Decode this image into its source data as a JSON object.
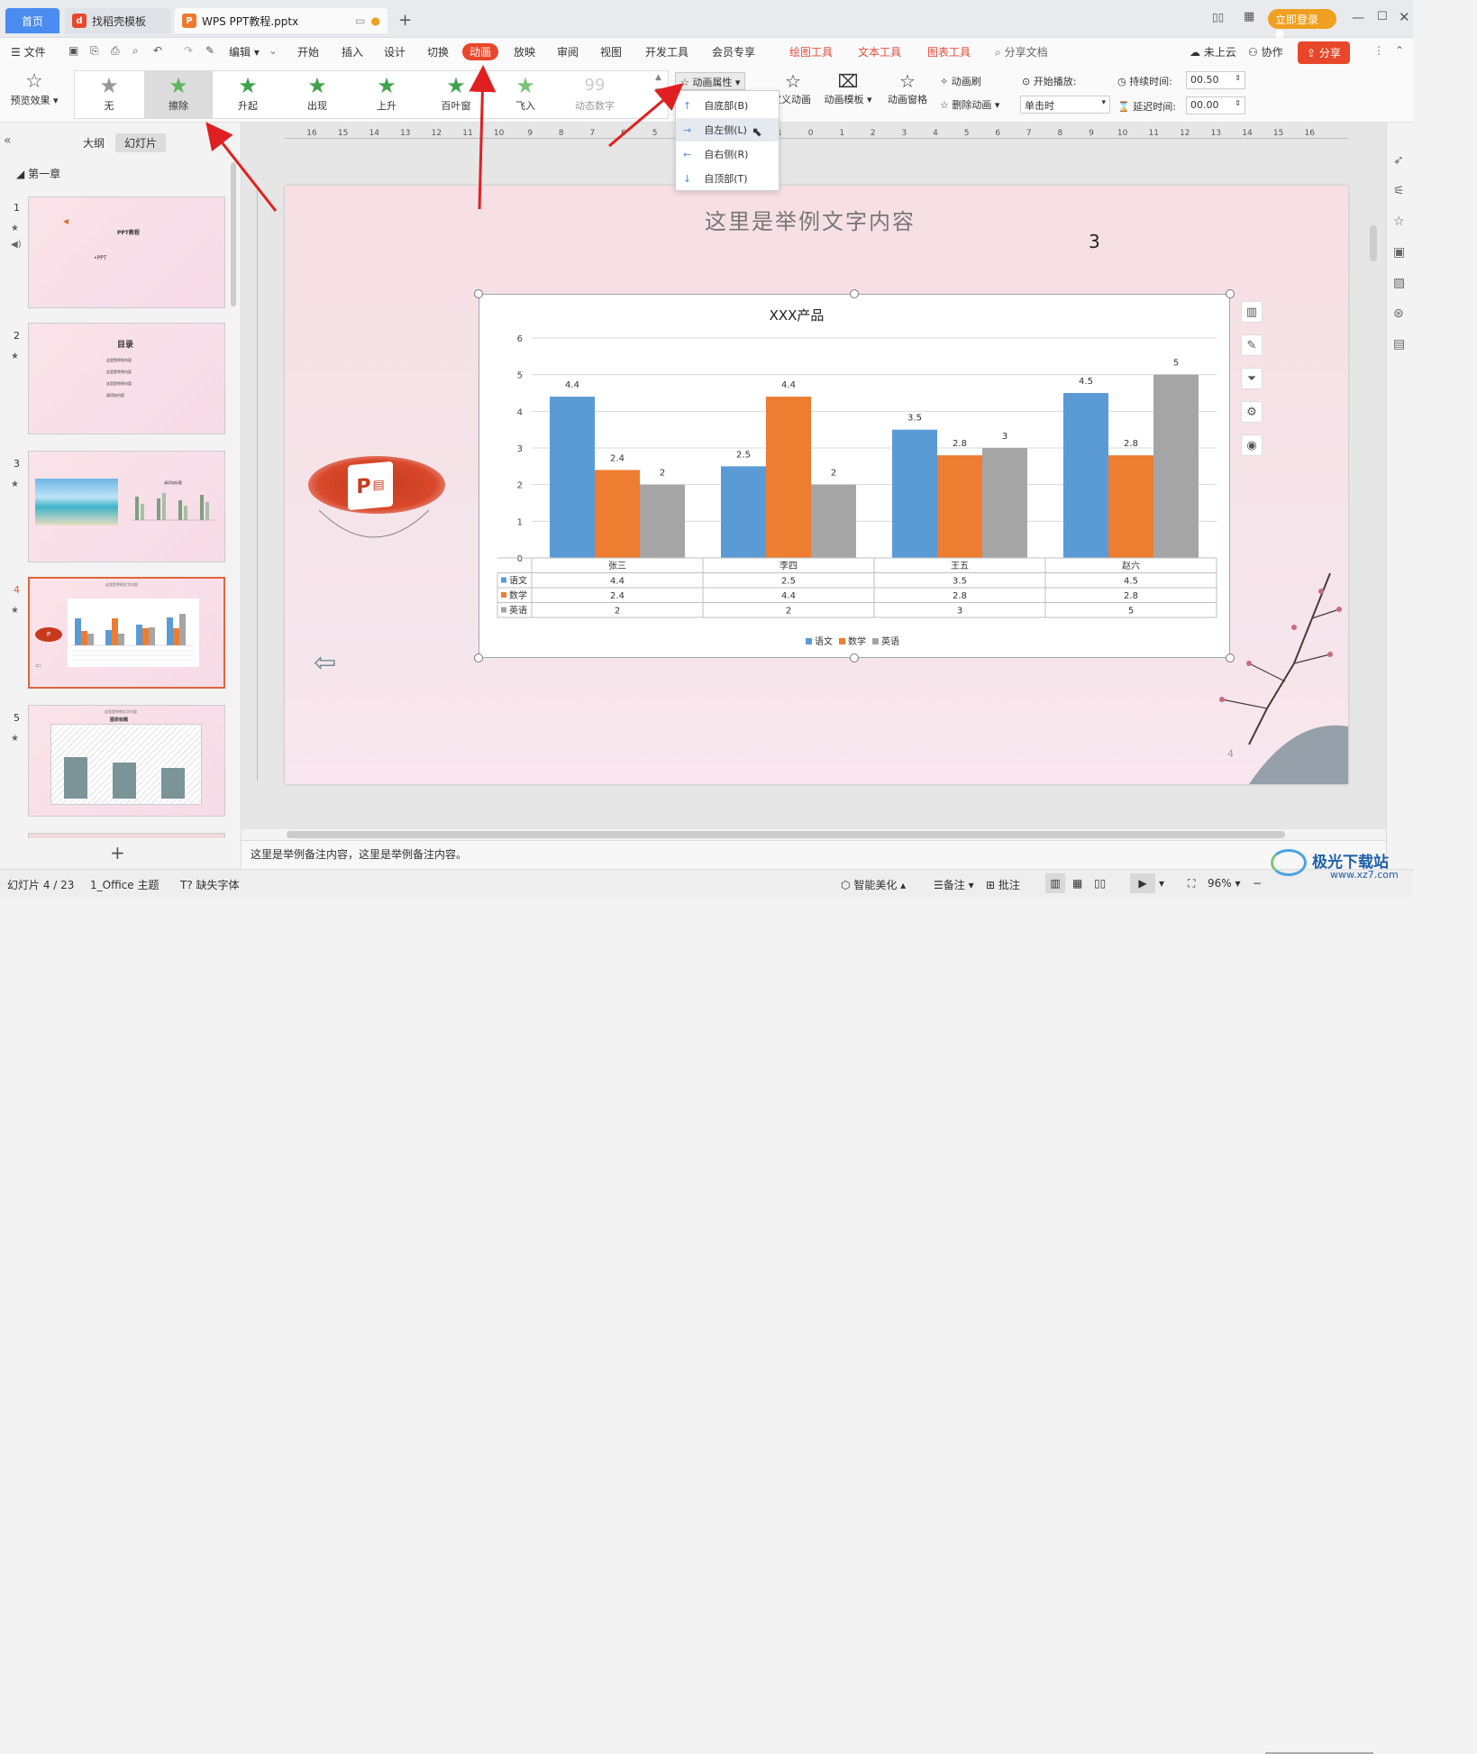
{
  "tabs": {
    "home": "首页",
    "template": "找稻壳模板",
    "doc": "WPS PPT教程.pptx"
  },
  "window": {
    "login": "立即登录"
  },
  "menu": {
    "file": "文件",
    "edit": "编辑",
    "items": [
      "开始",
      "插入",
      "设计",
      "切换",
      "动画",
      "放映",
      "审阅",
      "视图",
      "开发工具",
      "会员专享"
    ],
    "tools": [
      "绘图工具",
      "文本工具",
      "图表工具"
    ],
    "search": "分享文档",
    "cloud": "未上云",
    "collab": "协作",
    "share": "分享"
  },
  "ribbon": {
    "preview": "预览效果",
    "effects": [
      "无",
      "擦除",
      "升起",
      "出现",
      "上升",
      "百叶窗",
      "飞入",
      "动态数字"
    ],
    "anim_props": "动画属性",
    "custom_anim": "自定义动画",
    "templates": "动画模板",
    "pane": "动画窗格",
    "brush": "动画刷",
    "delete": "删除动画",
    "start_label": "开始播放:",
    "start_value": "单击时",
    "duration_label": "持续时间:",
    "duration_value": "00.50",
    "delay_label": "延迟时间:",
    "delay_value": "00.00"
  },
  "dropdown": [
    "自底部(B)",
    "自左侧(L)",
    "自右侧(R)",
    "自顶部(T)"
  ],
  "left": {
    "outline": "大纲",
    "slides": "幻灯片",
    "section": "第一章",
    "thumbs": [
      {
        "num": "1",
        "title": "PPT教程",
        "sub": "•PPT"
      },
      {
        "num": "2",
        "title": "目录",
        "lines": [
          "这里是举例内容",
          "这里是举例内容",
          "这里是举例内容",
          "请添加内容"
        ]
      },
      {
        "num": "3",
        "title": "请添加标题"
      },
      {
        "num": "4",
        "title": "这里是举例文字内容"
      },
      {
        "num": "5",
        "title": "这里是举例文字内容",
        "sub": "图表标题"
      }
    ]
  },
  "slide": {
    "title": "这里是举例文字内容",
    "number": "3",
    "page": "4",
    "logo": "P"
  },
  "chart_data": {
    "type": "bar",
    "title": "XXX产品",
    "categories": [
      "张三",
      "李四",
      "王五",
      "赵六"
    ],
    "series": [
      {
        "name": "语文",
        "values": [
          4.4,
          2.5,
          3.5,
          4.5
        ],
        "color": "#5b9bd5"
      },
      {
        "name": "数学",
        "values": [
          2.4,
          4.4,
          2.8,
          2.8
        ],
        "color": "#ed7d31"
      },
      {
        "name": "英语",
        "values": [
          2,
          2,
          3,
          5
        ],
        "color": "#a5a5a5"
      }
    ],
    "ylim": [
      0,
      6
    ],
    "yticks": [
      "0",
      "1",
      "2",
      "3",
      "4",
      "5",
      "6"
    ],
    "legend": "bottom",
    "data_table": true
  },
  "notes": "这里是举例备注内容，这里是举例备注内容。",
  "status": {
    "slide": "幻灯片 4 / 23",
    "theme": "1_Office 主题",
    "font": "缺失字体",
    "beautify": "智能美化",
    "notes": "备注",
    "comment": "批注",
    "zoom": "96%"
  },
  "watermark": "极光下载站",
  "watermark_url": "www.xz7.com"
}
